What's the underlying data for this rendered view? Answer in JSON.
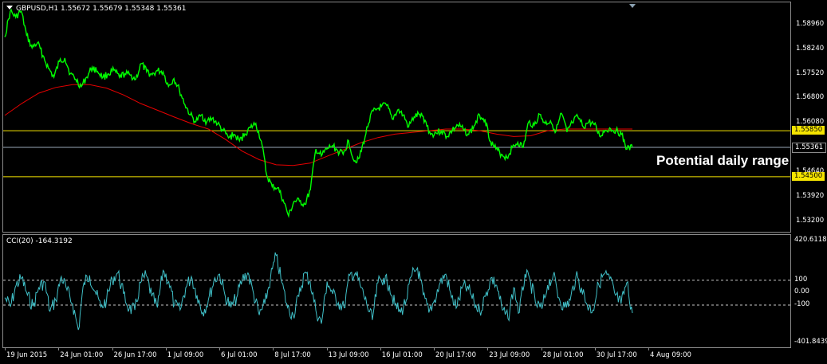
{
  "chart_data": [
    {
      "type": "line",
      "panel": "price",
      "header": "GBPUSD,H1  1.55672 1.55679 1.55348 1.55361",
      "symbol": "GBPUSD",
      "timeframe": "H1",
      "ohlc": {
        "open": "1.55672",
        "high": "1.55679",
        "low": "1.55348",
        "close": "1.55361"
      },
      "x_tick_labels": [
        "19 Jun 2015",
        "24 Jun 01:00",
        "26 Jun 17:00",
        "1 Jul 09:00",
        "6 Jul 01:00",
        "8 Jul 17:00",
        "13 Jul 09:00",
        "16 Jul 01:00",
        "20 Jul 17:00",
        "23 Jul 09:00",
        "28 Jul 01:00",
        "30 Jul 17:00",
        "4 Aug 09:00"
      ],
      "y_tick_labels": [
        "1.58960",
        "1.58240",
        "1.57520",
        "1.56800",
        "1.56080",
        "1.55361",
        "1.54640",
        "1.53920",
        "1.53200"
      ],
      "ylim": [
        1.5305,
        1.5945
      ],
      "levels": [
        {
          "label": "1.55850",
          "value": 1.5585,
          "color": "#f5e400"
        },
        {
          "label": "1.55361",
          "value": 1.55361,
          "color": "#9aa8b8"
        },
        {
          "label": "1.54500",
          "value": 1.545,
          "color": "#f5e400"
        }
      ],
      "annotation": "Potential daily range",
      "series": [
        {
          "color": "#00ff00",
          "values": [
            1.586,
            1.5935,
            1.5918,
            1.5936,
            1.5865,
            1.5828,
            1.5843,
            1.5805,
            1.5768,
            1.5742,
            1.5788,
            1.5798,
            1.5752,
            1.5736,
            1.5714,
            1.5742,
            1.5771,
            1.5759,
            1.5742,
            1.5752,
            1.5762,
            1.5742,
            1.5752,
            1.5748,
            1.5736,
            1.5782,
            1.5758,
            1.5749,
            1.5761,
            1.5758,
            1.5715,
            1.5738,
            1.5704,
            1.5662,
            1.5631,
            1.5611,
            1.5631,
            1.5611,
            1.5621,
            1.5605,
            1.5585,
            1.5564,
            1.5574,
            1.5555,
            1.5576,
            1.5594,
            1.5606,
            1.5555,
            1.5454,
            1.5421,
            1.5418,
            1.5382,
            1.5335,
            1.5378,
            1.5378,
            1.5369,
            1.5412,
            1.5531,
            1.5511,
            1.5531,
            1.5541,
            1.5526,
            1.5516,
            1.5556,
            1.5496,
            1.5506,
            1.5566,
            1.5631,
            1.5646,
            1.5656,
            1.5659,
            1.5619,
            1.5646,
            1.5631,
            1.5596,
            1.5626,
            1.5633,
            1.5616,
            1.5574,
            1.5579,
            1.5584,
            1.5568,
            1.5586,
            1.5601,
            1.5589,
            1.5574,
            1.5599,
            1.5631,
            1.5619,
            1.5554,
            1.5531,
            1.5516,
            1.5506,
            1.5536,
            1.5551,
            1.5536,
            1.5611,
            1.5601,
            1.5633,
            1.5606,
            1.5614,
            1.5584,
            1.5636,
            1.5581,
            1.5608,
            1.5626,
            1.5596,
            1.5611,
            1.5603,
            1.5569,
            1.5586,
            1.5591,
            1.5586,
            1.5574,
            1.5531,
            1.5536
          ]
        },
        {
          "color": "#e80000",
          "values": [
            1.563,
            1.5665,
            1.5695,
            1.5712,
            1.572,
            1.572,
            1.571,
            1.569,
            1.5665,
            1.5645,
            1.5625,
            1.5606,
            1.559,
            1.556,
            1.5525,
            1.55,
            1.5485,
            1.5483,
            1.549,
            1.551,
            1.553,
            1.555,
            1.5565,
            1.5575,
            1.558,
            1.5585,
            1.559,
            1.559,
            1.5585,
            1.5575,
            1.5568,
            1.557,
            1.5585,
            1.559,
            1.559,
            1.559,
            1.559,
            1.559
          ]
        }
      ]
    },
    {
      "type": "line",
      "panel": "indicator",
      "header": "CCI(20) -164.3192",
      "y_tick_labels": [
        "420.6118",
        "100",
        "0.00",
        "-100",
        "-401.8439"
      ],
      "ylim": [
        -401.8439,
        420.6118
      ],
      "levels": [
        100,
        -100
      ],
      "series": [
        {
          "name": "CCI(20)",
          "color": "#40c0c8",
          "values": [
            -40,
            -110,
            60,
            120,
            -20,
            -110,
            40,
            90,
            -150,
            -60,
            130,
            20,
            -90,
            -300,
            80,
            140,
            10,
            -120,
            -60,
            110,
            160,
            -10,
            -130,
            -140,
            80,
            140,
            -30,
            -120,
            180,
            90,
            -100,
            -140,
            40,
            130,
            -20,
            -160,
            -60,
            100,
            150,
            -30,
            -120,
            -40,
            110,
            160,
            -10,
            -180,
            -90,
            120,
            300,
            80,
            -120,
            -180,
            -30,
            160,
            90,
            -140,
            -250,
            90,
            -10,
            -80,
            -120,
            140,
            160,
            40,
            -90,
            -220,
            80,
            120,
            60,
            -100,
            -160,
            -60,
            140,
            200,
            -20,
            -160,
            -60,
            80,
            150,
            -40,
            -110,
            50,
            30,
            -80,
            -150,
            -30,
            120,
            60,
            -140,
            -210,
            40,
            -160,
            150,
            80,
            -100,
            -130,
            60,
            140,
            -40,
            -120,
            -60,
            130,
            40,
            -100,
            -140,
            70,
            150,
            110,
            -20,
            -90,
            80,
            -164
          ]
        }
      ]
    }
  ]
}
